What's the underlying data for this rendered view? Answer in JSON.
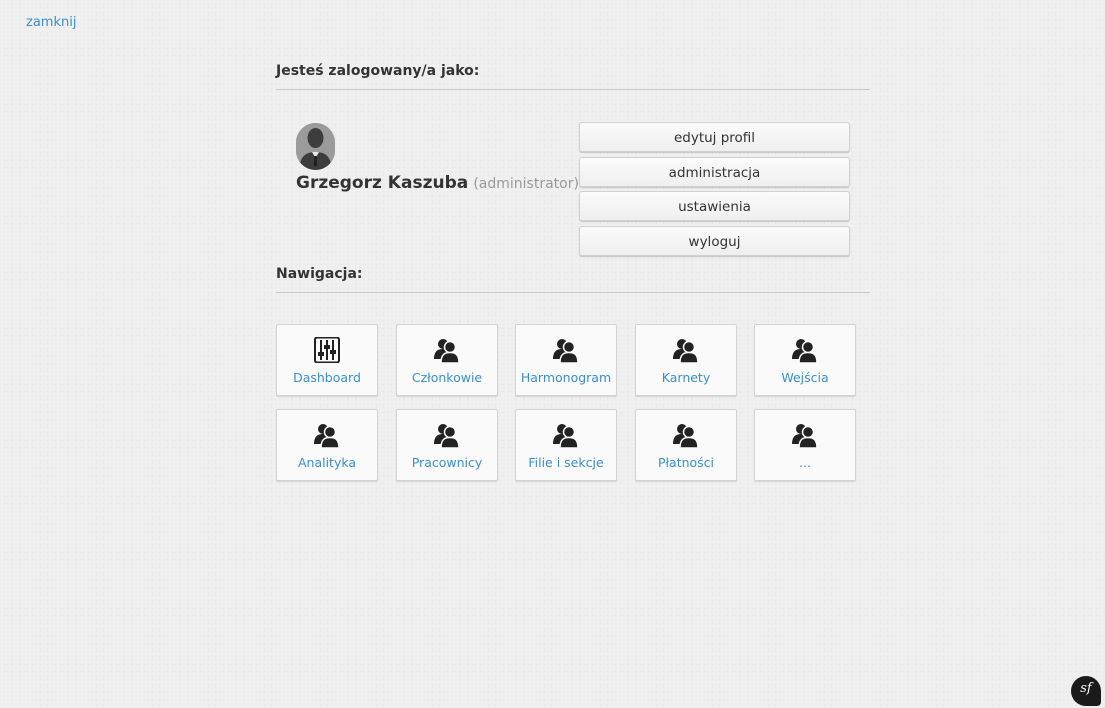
{
  "close_link": "zamknij",
  "logged_in_title": "Jesteś zalogowany/a jako:",
  "user": {
    "name": "Grzegorz Kaszuba",
    "role": "(administrator)"
  },
  "actions": [
    "edytuj profil",
    "administracja",
    "ustawienia",
    "wyloguj"
  ],
  "nav_title": "Nawigacja:",
  "nav_items": [
    {
      "label": "Dashboard",
      "icon": "sliders-icon"
    },
    {
      "label": "Członkowie",
      "icon": "users-icon"
    },
    {
      "label": "Harmonogram",
      "icon": "users-icon"
    },
    {
      "label": "Karnety",
      "icon": "users-icon"
    },
    {
      "label": "Wejścia",
      "icon": "users-icon"
    },
    {
      "label": "Analityka",
      "icon": "users-icon"
    },
    {
      "label": "Pracownicy",
      "icon": "users-icon"
    },
    {
      "label": "Filie i sekcje",
      "icon": "users-icon"
    },
    {
      "label": "Płatności",
      "icon": "users-icon"
    },
    {
      "label": "...",
      "icon": "users-icon"
    }
  ],
  "footer_logo": "sf",
  "colors": {
    "link": "#3a8fc9",
    "text": "#333333",
    "muted": "#999999",
    "background": "#eeeeee"
  }
}
